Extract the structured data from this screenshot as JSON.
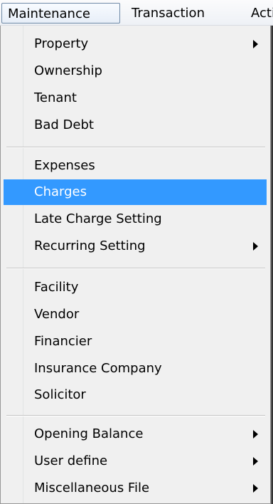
{
  "menubar": {
    "items": [
      "Maintenance",
      "Transaction",
      "Activ"
    ]
  },
  "menu": {
    "items": [
      {
        "label": "Property"
      },
      {
        "label": "Ownership"
      },
      {
        "label": "Tenant"
      },
      {
        "label": "Bad Debt"
      },
      {
        "label": "Expenses"
      },
      {
        "label": "Charges"
      },
      {
        "label": "Late Charge Setting"
      },
      {
        "label": "Recurring Setting"
      },
      {
        "label": "Facility"
      },
      {
        "label": "Vendor"
      },
      {
        "label": "Financier"
      },
      {
        "label": "Insurance Company"
      },
      {
        "label": "Solicitor"
      },
      {
        "label": "Opening Balance"
      },
      {
        "label": "User define"
      },
      {
        "label": "Miscellaneous File"
      }
    ],
    "selected_label": "Charges"
  },
  "colors": {
    "selection": "#3399ff",
    "menu_background": "#f0f0f0"
  },
  "icons": [
    "submenu-arrow-icon"
  ]
}
